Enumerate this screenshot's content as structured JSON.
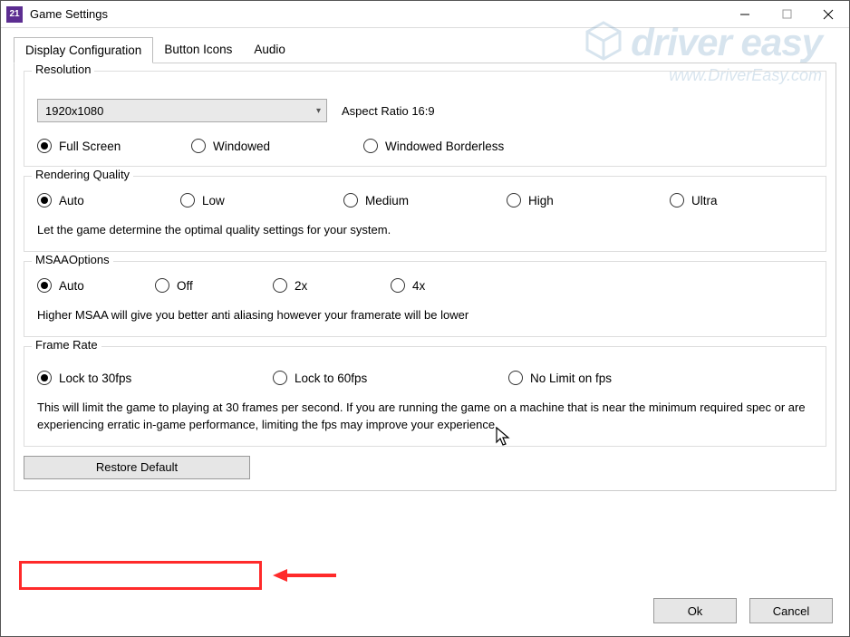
{
  "window": {
    "app_icon_text": "21",
    "title": "Game Settings"
  },
  "tabs": [
    {
      "label": "Display Configuration",
      "active": true
    },
    {
      "label": "Button Icons",
      "active": false
    },
    {
      "label": "Audio",
      "active": false
    }
  ],
  "resolution": {
    "legend": "Resolution",
    "selected": "1920x1080",
    "aspect_label": "Aspect Ratio 16:9",
    "modes": [
      {
        "label": "Full Screen",
        "checked": true
      },
      {
        "label": "Windowed",
        "checked": false
      },
      {
        "label": "Windowed Borderless",
        "checked": false
      }
    ]
  },
  "rendering": {
    "legend": "Rendering Quality",
    "options": [
      {
        "label": "Auto",
        "checked": true
      },
      {
        "label": "Low",
        "checked": false
      },
      {
        "label": "Medium",
        "checked": false
      },
      {
        "label": "High",
        "checked": false
      },
      {
        "label": "Ultra",
        "checked": false
      }
    ],
    "hint": "Let the game determine the optimal quality settings for your system."
  },
  "msaa": {
    "legend": "MSAAOptions",
    "options": [
      {
        "label": "Auto",
        "checked": true
      },
      {
        "label": "Off",
        "checked": false
      },
      {
        "label": "2x",
        "checked": false
      },
      {
        "label": "4x",
        "checked": false
      }
    ],
    "hint": "Higher MSAA will give you better anti aliasing however your framerate will be lower"
  },
  "framerate": {
    "legend": "Frame Rate",
    "options": [
      {
        "label": "Lock  to 30fps",
        "checked": true
      },
      {
        "label": "Lock to 60fps",
        "checked": false
      },
      {
        "label": "No Limit on fps",
        "checked": false
      }
    ],
    "hint": "This will limit the game to playing at 30 frames per second. If you are running the game on a machine that is near the minimum required spec or are experiencing erratic in-game performance, limiting the fps may improve your experience."
  },
  "buttons": {
    "restore": "Restore Default",
    "ok": "Ok",
    "cancel": "Cancel"
  },
  "watermark": {
    "line1": "driver easy",
    "line2": "www.DriverEasy.com"
  },
  "annotation": {
    "highlight_color": "#ff2a2a"
  }
}
